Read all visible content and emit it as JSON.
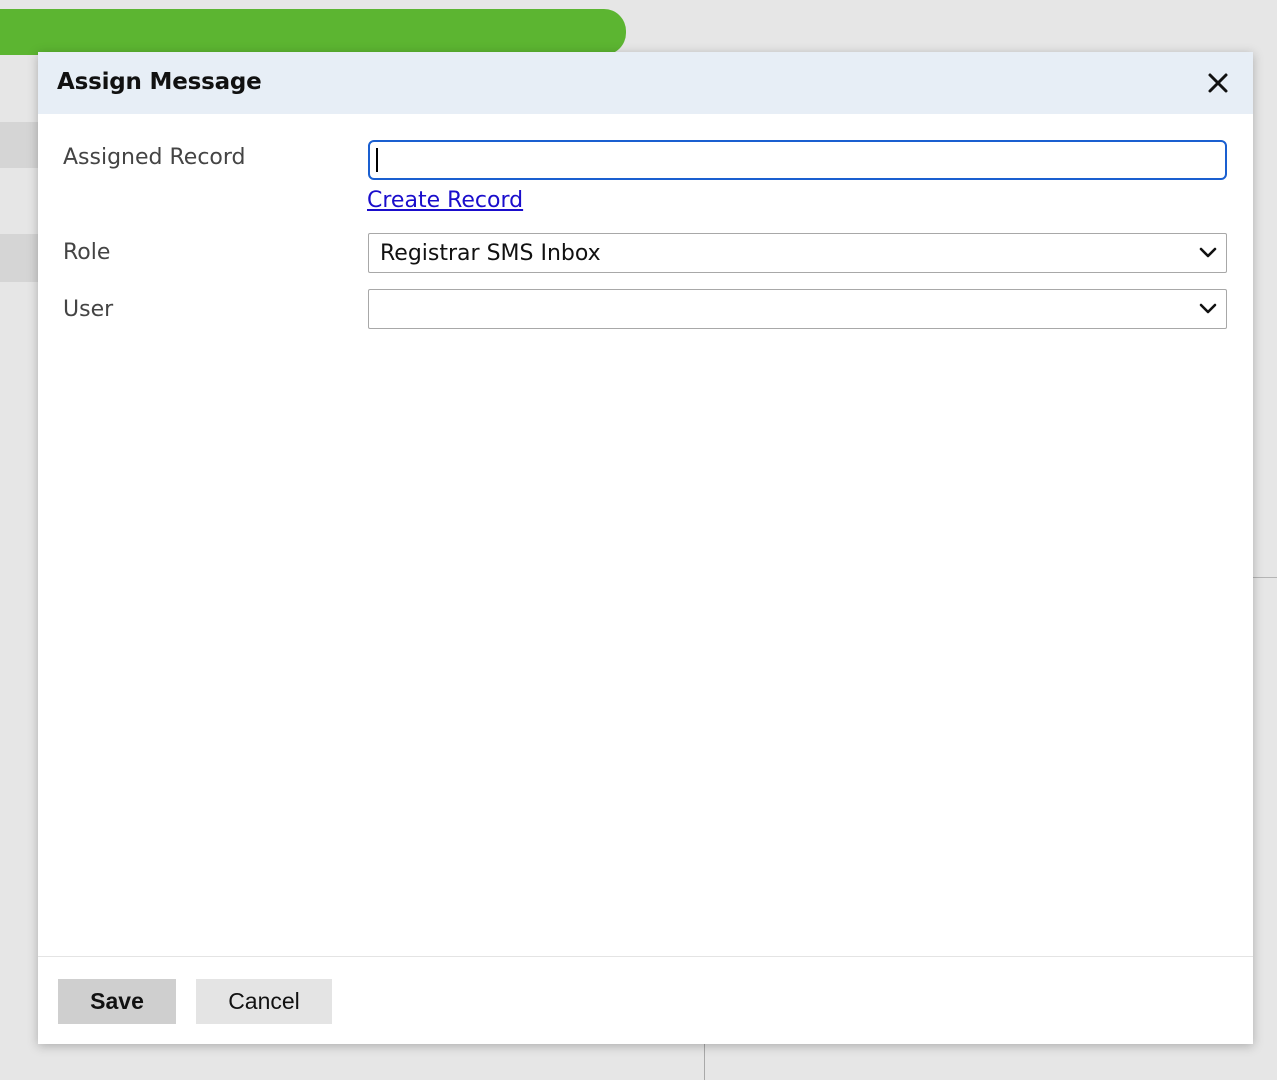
{
  "dialog": {
    "title": "Assign Message",
    "close_icon": "close-icon",
    "fields": {
      "assigned_record": {
        "label": "Assigned Record",
        "value": "",
        "placeholder": ""
      },
      "create_record_link": "Create Record",
      "role": {
        "label": "Role",
        "selected": "Registrar SMS Inbox"
      },
      "user": {
        "label": "User",
        "selected": ""
      }
    },
    "footer": {
      "save_label": "Save",
      "cancel_label": "Cancel"
    }
  },
  "colors": {
    "accent_green": "#5cb531",
    "header_bg": "#e7eef6",
    "focus_border": "#1a5fd0",
    "link": "#1a0dcc"
  }
}
